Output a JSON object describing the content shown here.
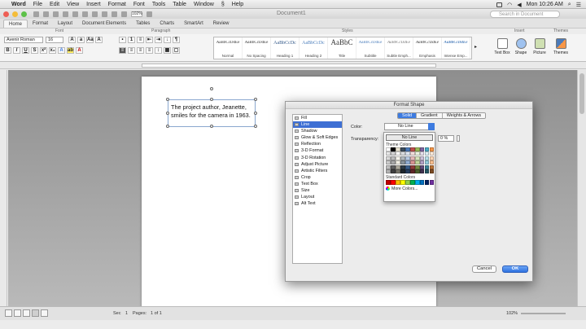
{
  "menubar": {
    "app": "Word",
    "items": [
      "File",
      "Edit",
      "View",
      "Insert",
      "Format",
      "Font",
      "Tools",
      "Table",
      "Window",
      "Help"
    ],
    "clock": "Mon 10:26 AM"
  },
  "window": {
    "title": "Document1",
    "search_placeholder": "Search in Document"
  },
  "ribbon": {
    "tabs": [
      "Home",
      "Format",
      "Layout",
      "Document Elements",
      "Tables",
      "Charts",
      "SmartArt",
      "Review"
    ],
    "group_labels": [
      "Font",
      "Paragraph",
      "Styles",
      "Insert",
      "Themes"
    ],
    "font_name": "Avenir Roman",
    "font_size": "16",
    "zoom": "102%",
    "styles": [
      {
        "sample": "AaBbCcDdEe",
        "name": "Normal"
      },
      {
        "sample": "AaBbCcDdEe",
        "name": "No Spacing"
      },
      {
        "sample": "AaBbCcDc",
        "name": "Heading 1"
      },
      {
        "sample": "AaBbCcDc",
        "name": "Heading 2"
      },
      {
        "sample": "AaBbC",
        "name": "Title"
      },
      {
        "sample": "AaBbCcDdEe",
        "name": "Subtitle"
      },
      {
        "sample": "AaBbCcDdEe",
        "name": "Subtle Emph..."
      },
      {
        "sample": "AaBbCcDdEe",
        "name": "Emphasis"
      },
      {
        "sample": "AaBbCcDdEe",
        "name": "Intense Emp..."
      }
    ],
    "insert_buttons": [
      "Text Box",
      "Shape",
      "Picture"
    ],
    "themes_button": "Themes"
  },
  "document": {
    "textbox_text": "The project author, Jeanette, smiles for the camera in 1963."
  },
  "statusbar": {
    "sec_label": "Sec",
    "sec_value": "1",
    "pages_label": "Pages:",
    "pages_value": "1 of 1",
    "zoom": "102%"
  },
  "dialog": {
    "title": "Format Shape",
    "categories": [
      "Fill",
      "Line",
      "Shadow",
      "Glow & Soft Edges",
      "Reflection",
      "3-D Format",
      "3-D Rotation",
      "Adjust Picture",
      "Artistic Filters",
      "Crop",
      "Text Box",
      "Size",
      "Layout",
      "Alt Text"
    ],
    "selected_category": "Line",
    "segments": [
      "Solid",
      "Gradient",
      "Weights & Arrows"
    ],
    "color_label": "Color:",
    "color_value": "No Line",
    "transparency_label": "Transparency:",
    "transparency_value": "0 %",
    "popup": {
      "no_line": "No Line",
      "theme_colors_label": "Theme Colors",
      "standard_colors_label": "Standard Colors",
      "more_colors": "More Colors..."
    },
    "cancel": "Cancel",
    "ok": "OK"
  },
  "colors": {
    "accent": "#3d7be0",
    "theme_top": [
      "#ffffff",
      "#000000",
      "#e8e3d1",
      "#3c4d5c",
      "#4b7ab8",
      "#c0504d",
      "#9bbb59",
      "#8064a2",
      "#4bacc6",
      "#f79646"
    ],
    "standard": [
      "#c00000",
      "#ff0000",
      "#ffc000",
      "#ffff00",
      "#92d050",
      "#00b050",
      "#00b0f0",
      "#0070c0",
      "#002060",
      "#7030a0"
    ]
  }
}
